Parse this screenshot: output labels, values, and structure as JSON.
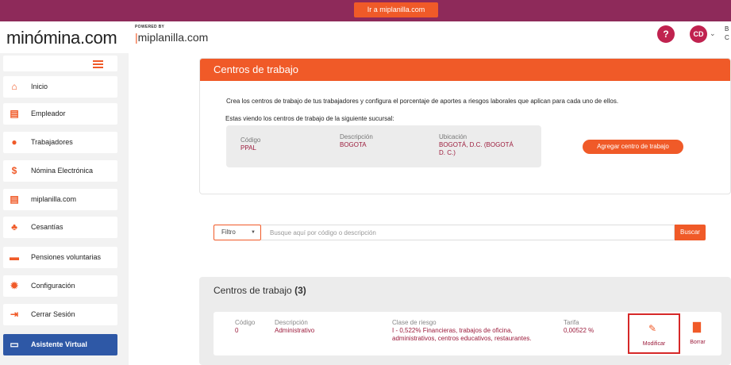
{
  "topbar": {
    "button_label": "Ir a miplanilla.com"
  },
  "header": {
    "logo": "minómina.com",
    "powered_by": "POWERED BY",
    "partner_logo": "miplanilla.com",
    "user_initials": "CD",
    "user_text_line1": "B",
    "user_text_line2": "C"
  },
  "sidebar": {
    "items": [
      {
        "label": "Inicio",
        "icon": "home-icon"
      },
      {
        "label": "Empleador",
        "icon": "building-icon"
      },
      {
        "label": "Trabajadores",
        "icon": "users-icon"
      },
      {
        "label": "Nómina Electrónica",
        "icon": "dollar-icon"
      },
      {
        "label": "miplanilla.com",
        "icon": "building-icon"
      },
      {
        "label": "Cesantías",
        "icon": "piggy-bank-icon"
      },
      {
        "label": "Pensiones voluntarias",
        "icon": "money-icon"
      },
      {
        "label": "Configuración",
        "icon": "gear-icon"
      },
      {
        "label": "Cerrar Sesión",
        "icon": "logout-icon"
      },
      {
        "label": "Asistente Virtual",
        "icon": "chat-icon"
      }
    ]
  },
  "centros": {
    "title": "Centros de trabajo",
    "description": "Crea los centros de trabajo de tus trabajadores y configura el porcentaje de aportes a riesgos laborales que aplican para cada uno de ellos.",
    "subtitle": "Estas viendo los centros de trabajo de la siguiente sucursal:",
    "branch": {
      "code_label": "Código",
      "code": "PPAL",
      "desc_label": "Descripción",
      "desc": "BOGOTA",
      "loc_label": "Ubicación",
      "loc_line1": "BOGOTÁ, D.C. (BOGOTÁ",
      "loc_line2": "D. C.)"
    },
    "add_button": "Agregar centro de trabajo"
  },
  "filter": {
    "select_value": "Filtro",
    "placeholder": "Busque aquí por código o descripción",
    "search_button": "Buscar"
  },
  "list": {
    "title": "Centros de trabajo",
    "count": "(3)",
    "rows": [
      {
        "code_label": "Código",
        "code": "0",
        "desc_label": "Descripción",
        "desc": "Administrativo",
        "risk_label": "Clase de riesgo",
        "risk_line1": "I - 0,522% Financieras, trabajos de oficina,",
        "risk_line2": "administrativos, centros educativos, restaurantes.",
        "rate_label": "Tarifa",
        "rate": "0,00522 %",
        "modify_label": "Modificar",
        "delete_label": "Borrar"
      }
    ]
  }
}
